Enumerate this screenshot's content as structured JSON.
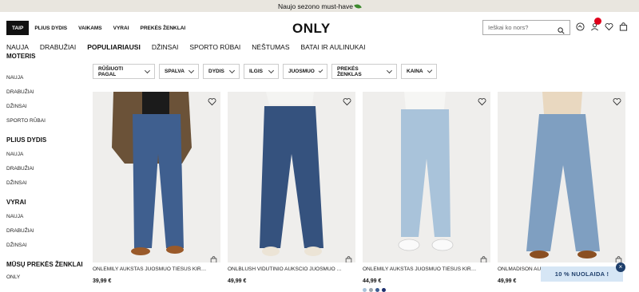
{
  "promo": {
    "text": "Naujo sezono must-have"
  },
  "top_tabs": [
    {
      "label": "TAIP"
    },
    {
      "label": "PLIUS DYDIS"
    },
    {
      "label": "VAIKAMS"
    },
    {
      "label": "VYRAI"
    },
    {
      "label": "PREKĖS ŽENKLAI"
    }
  ],
  "logo": "ONLY",
  "search": {
    "placeholder": "Ieškai ko nors?"
  },
  "main_nav": [
    {
      "label": "NAUJA"
    },
    {
      "label": "DRABUŽIAI"
    },
    {
      "label": "POPULIARIAUSI"
    },
    {
      "label": "DŽINSAI"
    },
    {
      "label": "SPORTO RŪBAI"
    },
    {
      "label": "NĖŠTUMAS"
    },
    {
      "label": "BATAI IR AULINUKAI"
    }
  ],
  "sidebar": {
    "sections": [
      {
        "title": "MOTERIS",
        "items": [
          "NAUJA",
          "DRABUŽIAI",
          "DŽINSAI",
          "SPORTO RŪBAI"
        ]
      },
      {
        "title": "PLIUS DYDIS",
        "items": [
          "NAUJA",
          "DRABUŽIAI",
          "DŽINSAI"
        ]
      },
      {
        "title": "VYRAI",
        "items": [
          "NAUJA",
          "DRABUŽIAI",
          "DŽINSAI"
        ]
      },
      {
        "title": "MŪSŲ PREKĖS ŽENKLAI",
        "items": [
          "ONLY"
        ]
      }
    ]
  },
  "filters": [
    {
      "label": "RŪŠIUOTI PAGAL"
    },
    {
      "label": "SPALVA"
    },
    {
      "label": "DYDIS"
    },
    {
      "label": "ILGIS"
    },
    {
      "label": "JUOSMUO"
    },
    {
      "label": "PREKĖS ŽENKLAS"
    },
    {
      "label": "KAINA"
    }
  ],
  "products": [
    {
      "name": "ONLEMILY AUKŠTAS JUOSMUO TIESUS KIRPIMAS TRUMPAS",
      "price": "39,99 €",
      "denim": "#3f5f8f",
      "top": "#6b5238"
    },
    {
      "name": "ONLBLUSH VIDUTINIO AUKŠČIO JUOSMUO TIESUS KIRPIMAS",
      "price": "49,99 €",
      "denim": "#35527e",
      "top": "#f4f4f2"
    },
    {
      "name": "ONLEMILY AUKŠTAS JUOSMUO TIESUS KIRPIMAS IKI KULKŠNIŲ",
      "price": "44,99 €",
      "denim": "#a9c3da",
      "top": "#f6f6f4"
    },
    {
      "name": "ONLMADISON AUKŠTAS JUOSMUO PLATUS KIRPIMAS",
      "price": "49,99 €",
      "denim": "#7f9fc1",
      "top": "#e9d8c0"
    }
  ],
  "swatches": [
    "#a9c3da",
    "#9aa4ad",
    "#3c5d91",
    "#1e2f6e"
  ],
  "discount": {
    "label": "10 % NUOLAIDA !",
    "close": "×"
  },
  "colors": {
    "accent": "#111111",
    "badge": "#e0001b",
    "discount_bg": "#d6e6f5",
    "discount_fg": "#1f3f6b"
  }
}
